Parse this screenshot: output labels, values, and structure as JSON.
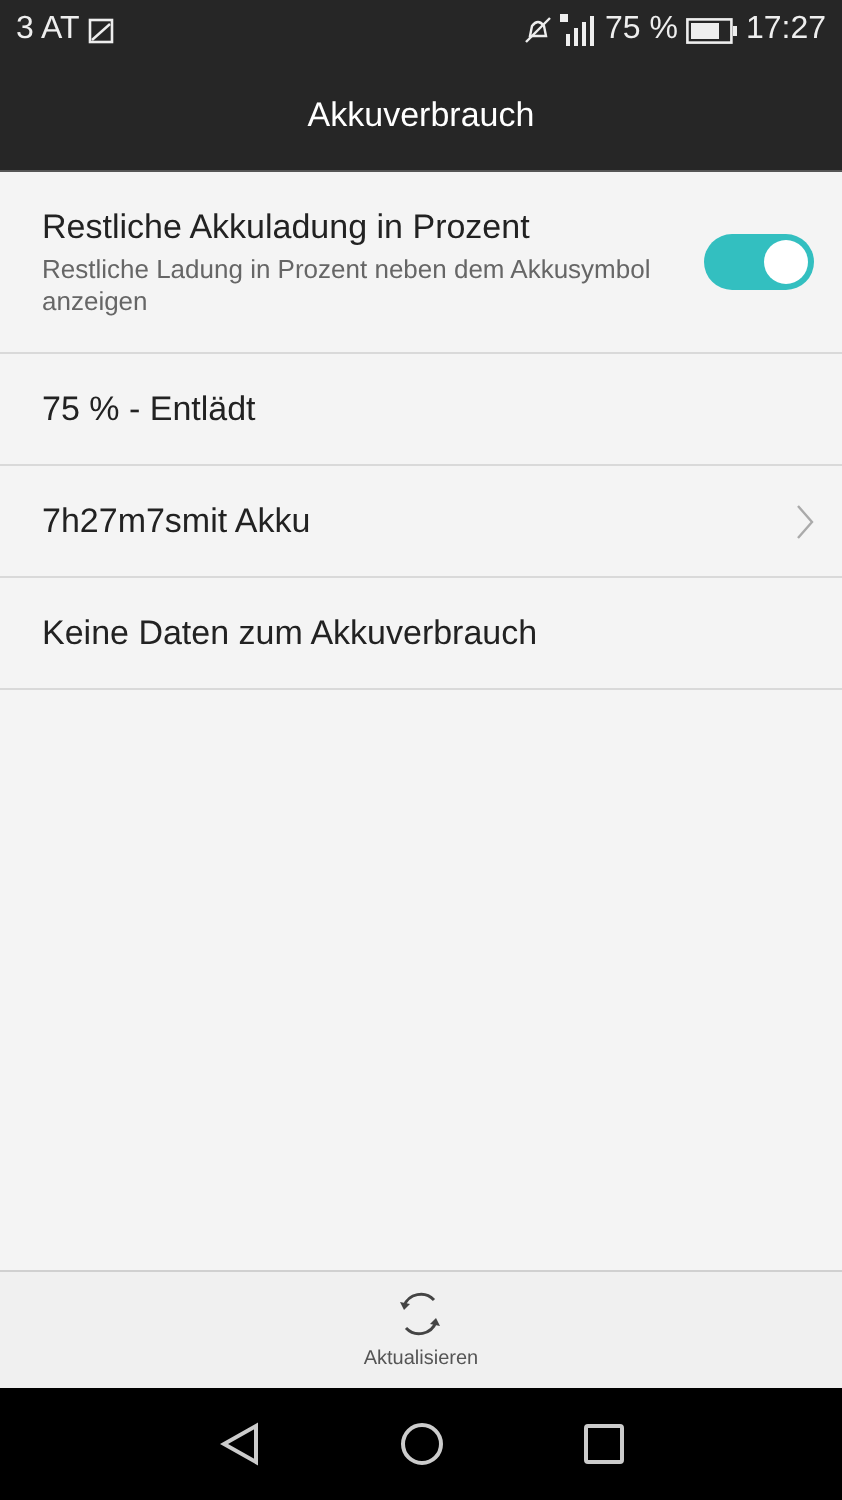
{
  "status_bar": {
    "carrier": "3 AT",
    "battery_percent": "75 %",
    "time": "17:27"
  },
  "header": {
    "title": "Akkuverbrauch"
  },
  "rows": [
    {
      "kind": "toggle",
      "title": "Restliche Akkuladung in Prozent",
      "subtitle": "Restliche Ladung in Prozent neben dem Akkusymbol anzeigen",
      "on": true
    },
    {
      "kind": "text",
      "title": "75 % - Entlädt"
    },
    {
      "kind": "link",
      "title": "7h27m7smit Akku"
    },
    {
      "kind": "text",
      "title": "Keine Daten zum Akkuverbrauch"
    }
  ],
  "bottom_action": {
    "label": "Aktualisieren"
  }
}
